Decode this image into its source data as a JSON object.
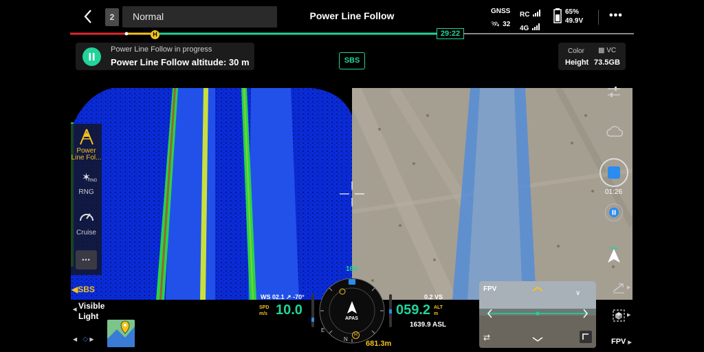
{
  "topbar": {
    "mode_number": "2",
    "mode_value": "Normal",
    "title": "Power Line Follow",
    "gnss_label": "GNSS",
    "gnss_count": "32",
    "rc_label": "RC",
    "net_label": "4G",
    "battery_percent": "65%",
    "battery_voltage": "49.9V"
  },
  "progress": {
    "time": "29:22",
    "home_marker": "H",
    "fraction": 0.655
  },
  "status_card": {
    "line1": "Power Line Follow in progress",
    "line2": "Power Line Follow altitude: 30 m"
  },
  "sbs_button": "SBS",
  "color_card": {
    "color_label": "Color",
    "vc_label": "VC",
    "height_label": "Height",
    "storage": "73.5GB"
  },
  "left_panel": {
    "items": [
      {
        "label": "Power Line Fol...",
        "icon": "power-line-icon"
      },
      {
        "label": "RNG",
        "icon": "rng-icon",
        "badge": "RNG"
      },
      {
        "label": "Cruise",
        "icon": "speedometer-icon"
      }
    ],
    "more": "•••",
    "sbs": "SBS"
  },
  "right_column": {
    "record_time": "01:26"
  },
  "telemetry": {
    "ws": "WS 02.1",
    "wind_dir": "-70°",
    "speed_label1": "SPD",
    "speed_label2": "m/s",
    "speed": "10.0",
    "heading": "166",
    "apas": "APAS",
    "distance": "681.3m",
    "vs": "0.2 VS",
    "alt": "059.2",
    "alt_label1": "ALT",
    "alt_label2": "m",
    "asl": "1639.9 ASL",
    "compass_n": "N",
    "compass_e": "E",
    "home": "H"
  },
  "bottom_left": {
    "visible_light_1": "Visible",
    "visible_light_2": "Light"
  },
  "fpv": {
    "label": "FPV",
    "bottom_label": "FPV"
  },
  "colors": {
    "accent": "#22d39a",
    "warning": "#f4c21d",
    "progress_red": "#e0282d"
  }
}
